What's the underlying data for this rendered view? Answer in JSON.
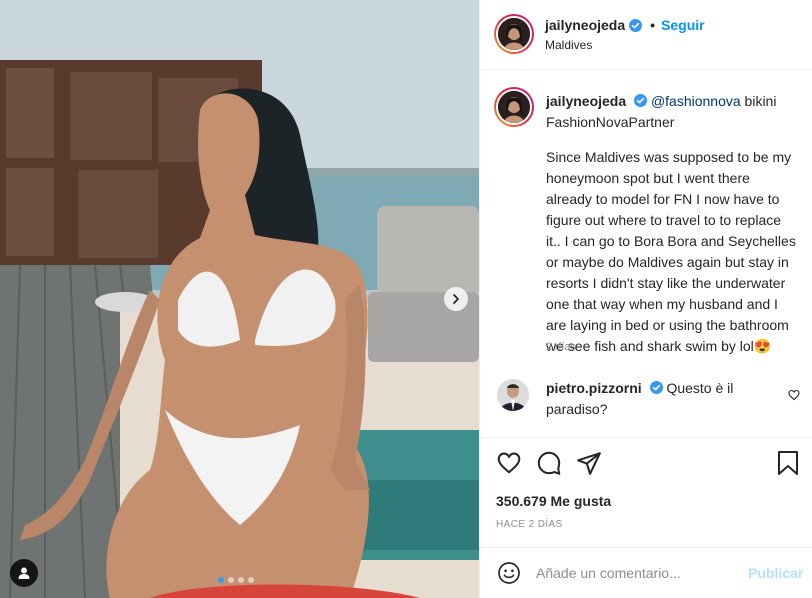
{
  "post": {
    "username": "jailyneojeda",
    "separator": "•",
    "follow_label": "Seguir",
    "location": "Maldives"
  },
  "caption": {
    "username": "jailyneojeda",
    "mention": "@fashionnova",
    "line1_rest": " bikini",
    "line2": "FashionNovaPartner",
    "body": "Since Maldives was supposed to be my honeymoon spot but I went there already to model for FN I now have to figure out where to travel to to replace it.. I can go to Bora Bora and Seychelles or maybe do Maldives again but stay in resorts I didn't stay like the underwater one that way when my husband and I are laying in bed or using the bathroom we see fish and shark swim by lol😍",
    "time": "2 días"
  },
  "comment": {
    "username": "pietro.pizzorni",
    "text": "Questo è il paradiso?"
  },
  "stats": {
    "likes": "350.679 Me gusta",
    "date": "HACE 2 DÍAS"
  },
  "add_comment": {
    "placeholder": "Añade un comentario...",
    "post_label": "Publicar"
  },
  "carousel": {
    "count": 4,
    "active": 0
  },
  "icons": {
    "verified": "verified-badge-icon",
    "next": "chevron-right-icon",
    "tag": "user-tag-icon",
    "like": "heart-icon",
    "comment": "comment-icon",
    "share": "paper-plane-icon",
    "save": "bookmark-icon",
    "emoji": "smiley-icon"
  },
  "colors": {
    "accent": "#0095f6",
    "verified": "#3897f0",
    "muted": "#8e8e8e"
  }
}
